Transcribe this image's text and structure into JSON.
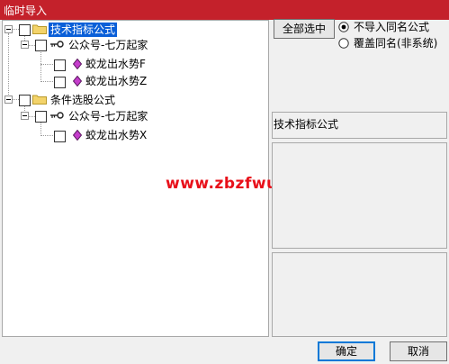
{
  "window": {
    "title": "临时导入"
  },
  "tree": {
    "groups": [
      {
        "label": "技术指标公式",
        "selected": true,
        "children": [
          {
            "label": "公众号-七万起家",
            "children": [
              {
                "label": "蛟龙出水势F"
              },
              {
                "label": "蛟龙出水势Z"
              }
            ]
          }
        ]
      },
      {
        "label": "条件选股公式",
        "selected": false,
        "children": [
          {
            "label": "公众号-七万起家",
            "children": [
              {
                "label": "蛟龙出水势X"
              }
            ]
          }
        ]
      }
    ]
  },
  "watermark": "www.zbzfwu.com",
  "controls": {
    "select_all_label": "全部选中",
    "option_skip_label": "不导入同名公式",
    "option_overwrite_label": "覆盖同名(非系统)",
    "selected_option": "option_skip"
  },
  "info_panel": {
    "title": "技术指标公式"
  },
  "footer": {
    "ok_label": "确定",
    "cancel_label": "取消"
  },
  "colors": {
    "title_bar": "#c4212b",
    "selection": "#0a5fd8",
    "watermark": "#e8101a"
  }
}
